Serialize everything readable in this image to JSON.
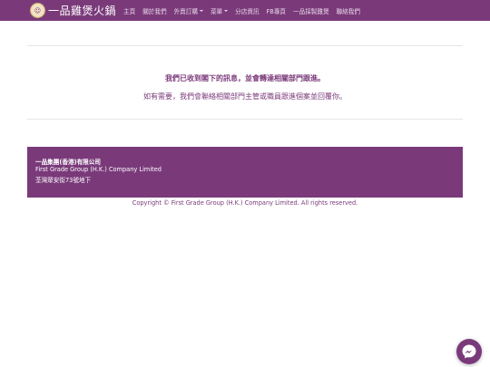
{
  "brand": {
    "name": "一品雞煲火鍋"
  },
  "nav": {
    "items": [
      {
        "label": "主頁",
        "dropdown": false
      },
      {
        "label": "關於我們",
        "dropdown": false
      },
      {
        "label": "外賣訂購",
        "dropdown": true
      },
      {
        "label": "菜單",
        "dropdown": true
      },
      {
        "label": "分店資訊",
        "dropdown": false
      },
      {
        "label": "FB專頁",
        "dropdown": false
      },
      {
        "label": "一品採製雞煲",
        "dropdown": false
      },
      {
        "label": "聯絡我們",
        "dropdown": false
      }
    ]
  },
  "main": {
    "message": "我們已收到閣下的訊息，並會轉達相關部門跟進。",
    "submessage": "如有需要，我們會聯絡相關部門主管或職員跟進個案並回覆你。"
  },
  "footer": {
    "company_cn": "一品集團(香港)有限公司",
    "company_en": "First Grade Group (H.K.) Company Limited",
    "address": "荃灣眾安街73號地下",
    "copyright": "Copyright © First Grade Group (H.K.) Company Limited. All rights reserved."
  },
  "colors": {
    "brand": "#7a3a7a",
    "background": "#ffffff"
  },
  "icons": {
    "messenger": "messenger-icon"
  }
}
